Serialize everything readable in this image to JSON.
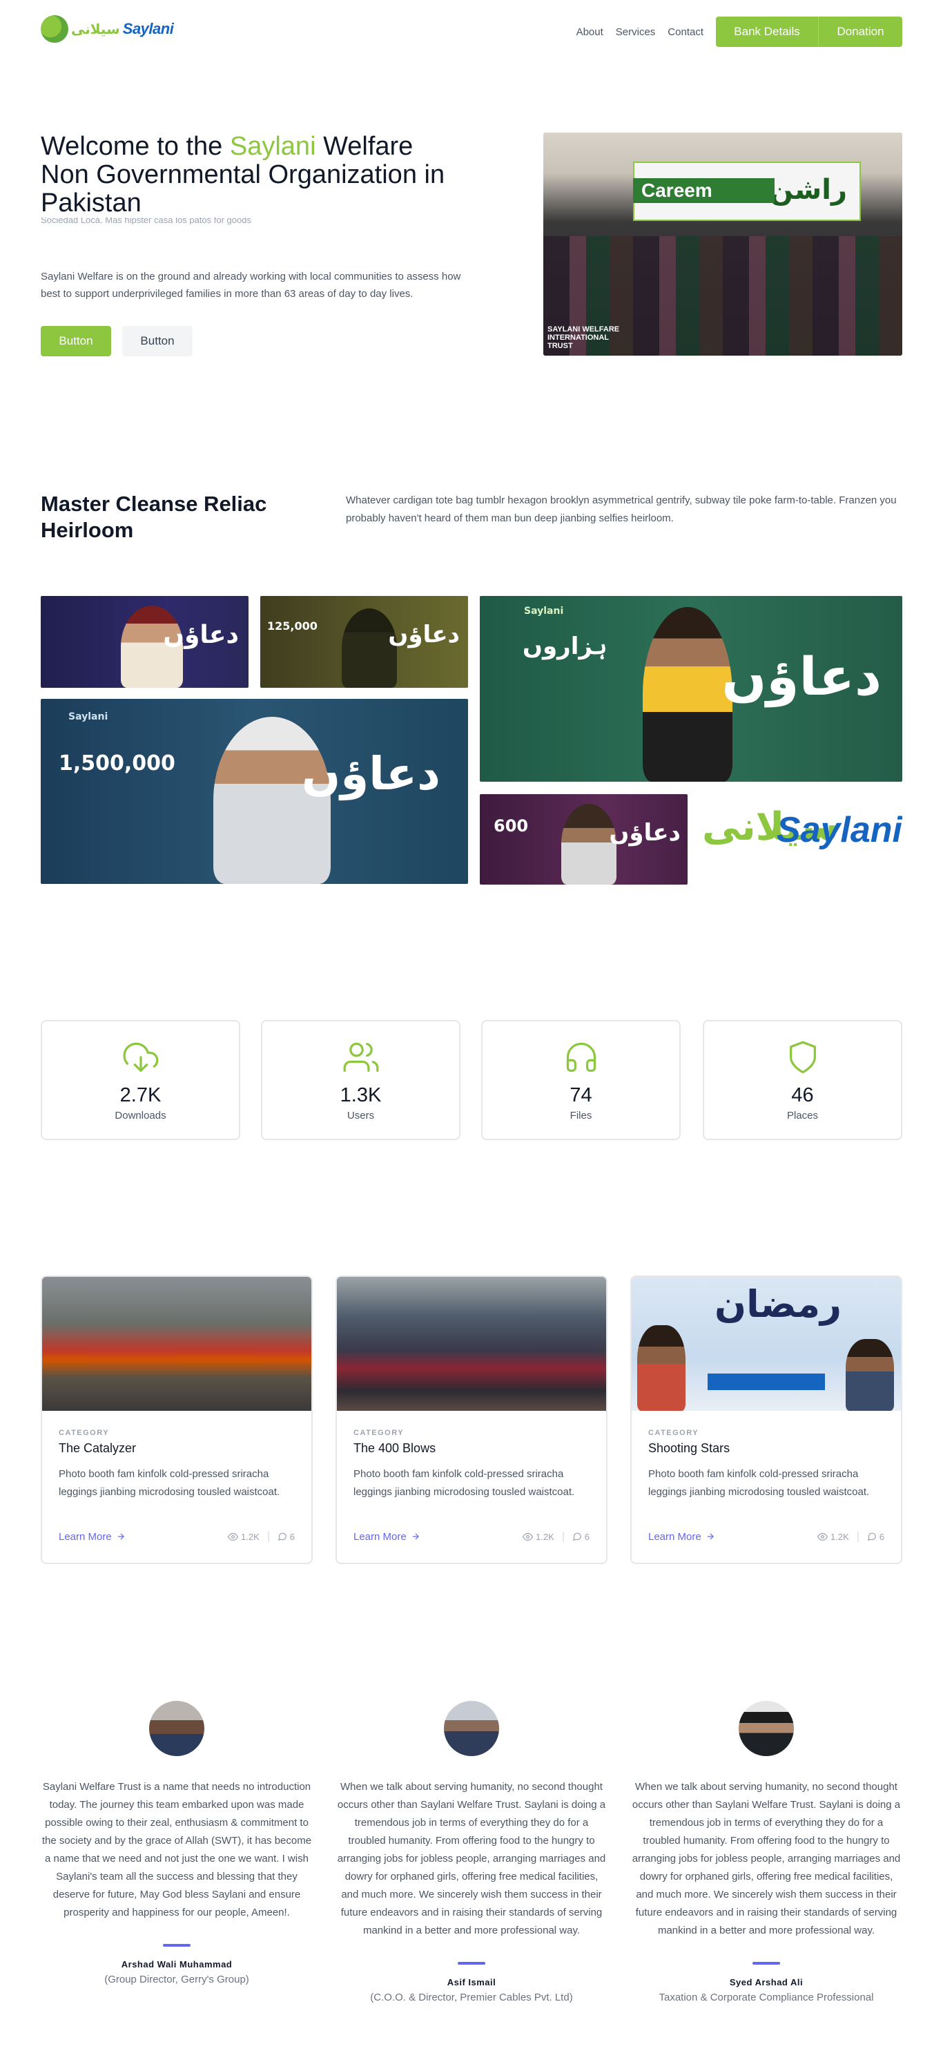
{
  "header": {
    "logo_word": "Saylani",
    "logo_urdu": "سیلانی",
    "nav": [
      "About",
      "Services",
      "Contact"
    ],
    "bank_btn": "Bank Details",
    "donate_btn": "Donation"
  },
  "hero": {
    "title_pre": "Welcome to the ",
    "title_accent": "Saylani",
    "title_post": " Welfare Non Governmental Organization in Pakistan",
    "ghost_text": "Sociedad Loca. Mas hipster casa los patos for goods",
    "text": "Saylani Welfare is on the ground and already working with local communities to assess how best to support underprivileged families in more than 63 areas of day to day lives.",
    "btn_primary": "Button",
    "btn_secondary": "Button",
    "image_banner_en": "Careem",
    "image_banner_ur": "راشن",
    "image_tag": "SAYLANI WELFARE INTERNATIONAL TRUST"
  },
  "section2": {
    "title": "Master Cleanse Reliac Heirloom",
    "text": "Whatever cardigan tote bag tumblr hexagon brooklyn asymmetrical gentrify, subway tile poke farm-to-table. Franzen you probably haven't heard of them man bun deep jianbing selfies heirloom."
  },
  "gallery": {
    "dua": "دعاؤں",
    "g1_num": "",
    "g2_num": "125,000",
    "g3_urdu": "ہزاروں",
    "g4_num": "1,500,000",
    "g5_num": "600",
    "g6_word": "Saylani",
    "g6_urdu": "سیلانی"
  },
  "stats": [
    {
      "icon": "download-icon",
      "value": "2.7K",
      "label": "Downloads"
    },
    {
      "icon": "users-icon",
      "value": "1.3K",
      "label": "Users"
    },
    {
      "icon": "headphones-icon",
      "value": "74",
      "label": "Files"
    },
    {
      "icon": "shield-icon",
      "value": "46",
      "label": "Places"
    }
  ],
  "cards": [
    {
      "category": "CATEGORY",
      "title": "The Catalyzer",
      "desc": "Photo booth fam kinfolk cold-pressed sriracha leggings jianbing microdosing tousled waistcoat.",
      "more": "Learn More",
      "views": "1.2K",
      "comments": "6"
    },
    {
      "category": "CATEGORY",
      "title": "The 400 Blows",
      "desc": "Photo booth fam kinfolk cold-pressed sriracha leggings jianbing microdosing tousled waistcoat.",
      "more": "Learn More",
      "views": "1.2K",
      "comments": "6"
    },
    {
      "category": "CATEGORY",
      "title": "Shooting Stars",
      "desc": "Photo booth fam kinfolk cold-pressed sriracha leggings jianbing microdosing tousled waistcoat.",
      "more": "Learn More",
      "views": "1.2K",
      "comments": "6",
      "image_title": "رمضان"
    }
  ],
  "testimonials": [
    {
      "text": "Saylani Welfare Trust is a name that needs no introduction today. The journey this team embarked upon was made possible owing to their zeal, enthusiasm & commitment to the society and by the grace of Allah (SWT), it has become a name that we need and not just the one we want. I wish Saylani's team all the success and blessing that they deserve for future, May God bless Saylani and ensure prosperity and happiness for our people, Ameen!.",
      "name": "Arshad Wali Muhammad",
      "role": "(Group Director, Gerry's Group)"
    },
    {
      "text": "When we talk about serving humanity, no second thought occurs other than Saylani Welfare Trust. Saylani is doing a tremendous job in terms of everything they do for a troubled humanity. From offering food to the hungry to arranging jobs for jobless people, arranging marriages and dowry for orphaned girls, offering free medical facilities, and much more. We sincerely wish them success in their future endeavors and in raising their standards of serving mankind in a better and more professional way.",
      "name": "Asif Ismail",
      "role": "(C.O.O. & Director, Premier Cables Pvt. Ltd)"
    },
    {
      "text": "When we talk about serving humanity, no second thought occurs other than Saylani Welfare Trust. Saylani is doing a tremendous job in terms of everything they do for a troubled humanity. From offering food to the hungry to arranging jobs for jobless people, arranging marriages and dowry for orphaned girls, offering free medical facilities, and much more. We sincerely wish them success in their future endeavors and in raising their standards of serving mankind in a better and more professional way.",
      "name": "Syed Arshad Ali",
      "role": "Taxation & Corporate Compliance Professional"
    }
  ],
  "colors": {
    "brand_green": "#8dc63f",
    "brand_blue": "#1565c0",
    "accent_indigo": "#6366f1"
  }
}
